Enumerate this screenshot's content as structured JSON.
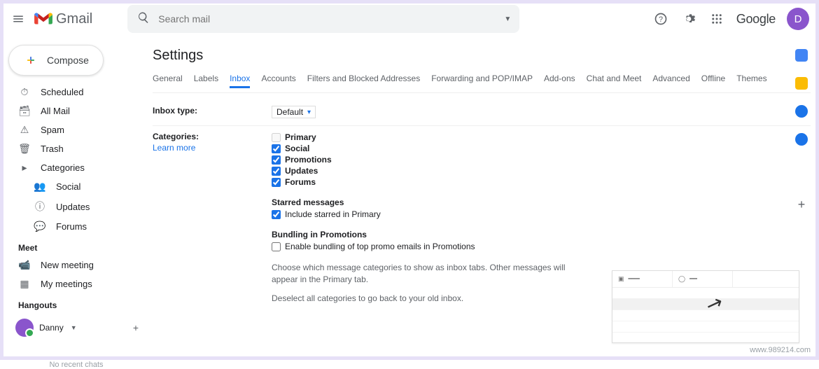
{
  "header": {
    "app_name": "Gmail",
    "search_placeholder": "Search mail",
    "google_label": "Google",
    "avatar_initial": "D"
  },
  "compose_label": "Compose",
  "sidebar": {
    "items": [
      {
        "icon": "⏱",
        "label": "Scheduled"
      },
      {
        "icon": "🗃",
        "label": "All Mail"
      },
      {
        "icon": "⚠",
        "label": "Spam"
      },
      {
        "icon": "🗑",
        "label": "Trash"
      },
      {
        "icon": "▸",
        "label": "Categories"
      }
    ],
    "sub_items": [
      {
        "icon": "👥",
        "label": "Social"
      },
      {
        "icon": "ⓘ",
        "label": "Updates"
      },
      {
        "icon": "💬",
        "label": "Forums"
      }
    ],
    "meet_title": "Meet",
    "meet_items": [
      {
        "icon": "📹",
        "label": "New meeting"
      },
      {
        "icon": "▦",
        "label": "My meetings"
      }
    ],
    "hangouts_title": "Hangouts",
    "hangouts_user": "Danny",
    "recent_chats": "No recent chats"
  },
  "page_title": "Settings",
  "tabs": [
    "General",
    "Labels",
    "Inbox",
    "Accounts",
    "Filters and Blocked Addresses",
    "Forwarding and POP/IMAP",
    "Add-ons",
    "Chat and Meet",
    "Advanced",
    "Offline",
    "Themes"
  ],
  "active_tab_index": 2,
  "inbox_type": {
    "label": "Inbox type:",
    "value": "Default"
  },
  "categories": {
    "label": "Categories:",
    "learn_more": "Learn more",
    "options": [
      {
        "label": "Primary",
        "checked": false,
        "disabled": true
      },
      {
        "label": "Social",
        "checked": true
      },
      {
        "label": "Promotions",
        "checked": true
      },
      {
        "label": "Updates",
        "checked": true
      },
      {
        "label": "Forums",
        "checked": true
      }
    ],
    "starred_head": "Starred messages",
    "starred_opt": {
      "label": "Include starred in Primary",
      "checked": true
    },
    "bundling_head": "Bundling in Promotions",
    "bundling_opt": {
      "label": "Enable bundling of top promo emails in Promotions",
      "checked": false
    },
    "desc1": "Choose which message categories to show as inbox tabs. Other messages will appear in the Primary tab.",
    "desc2": "Deselect all categories to go back to your old inbox."
  },
  "watermark": "www.989214.com"
}
